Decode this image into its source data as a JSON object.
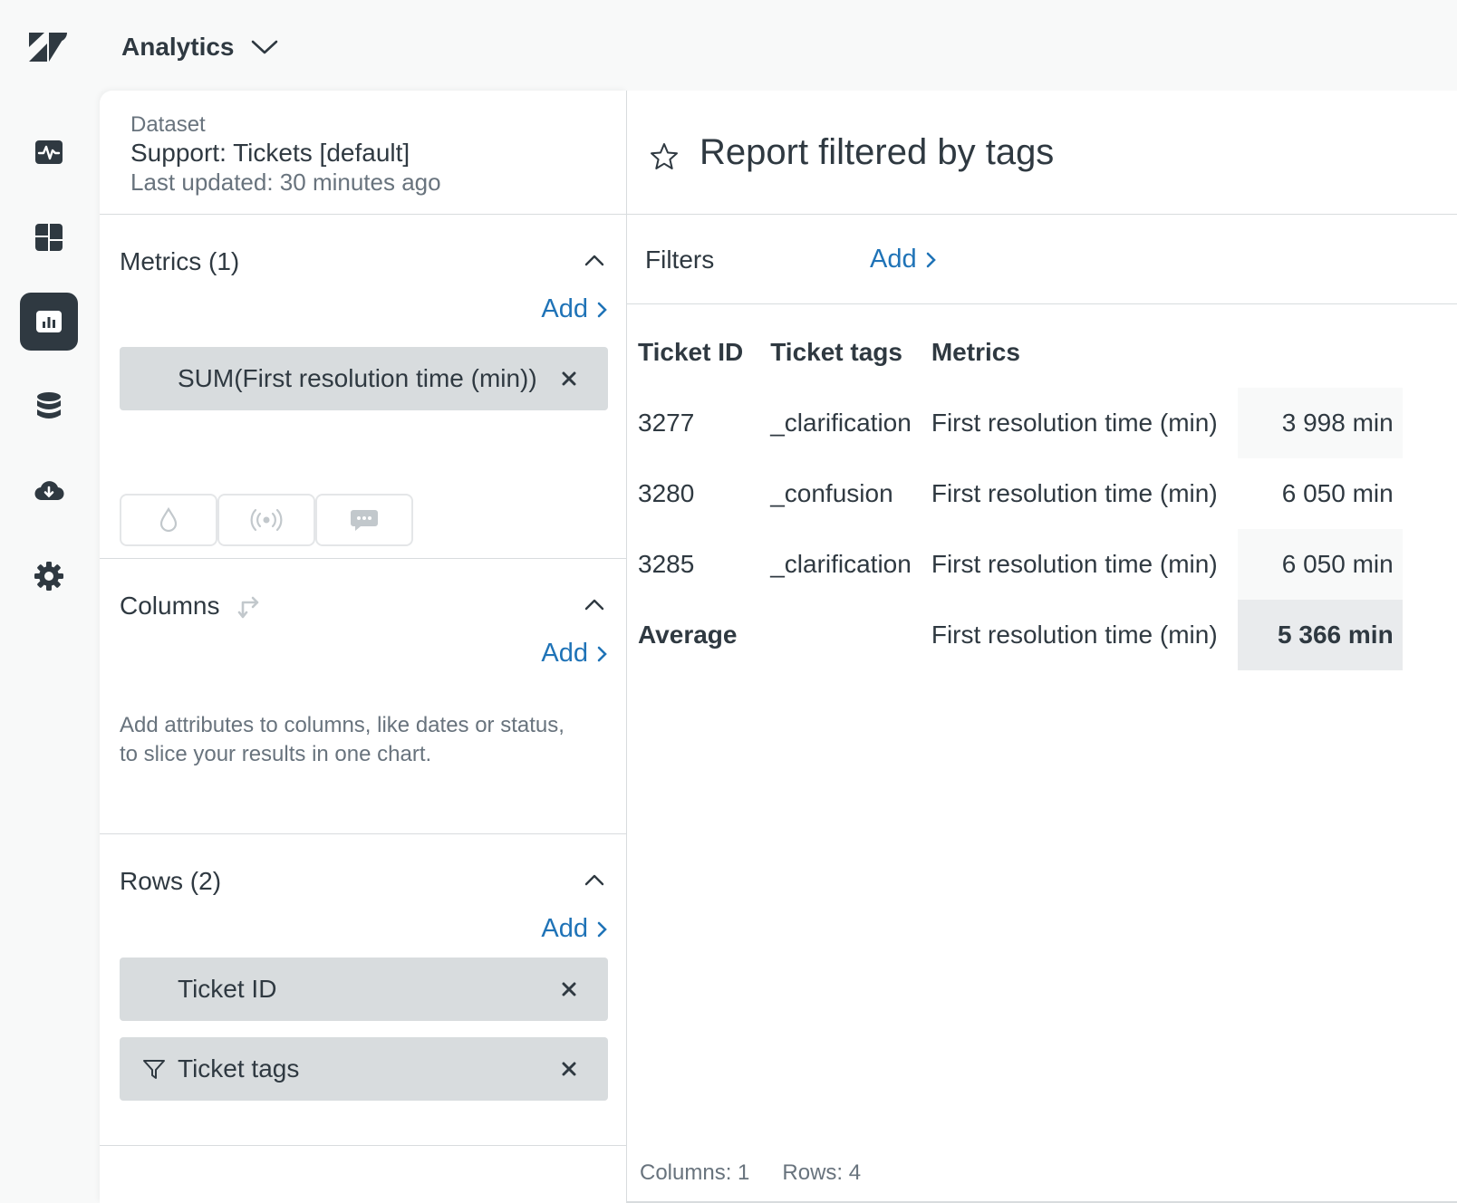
{
  "header": {
    "product": "Analytics"
  },
  "rail": {
    "items": [
      {
        "icon": "pulse-icon"
      },
      {
        "icon": "dashboard-icon"
      },
      {
        "icon": "reports-icon",
        "active": true
      },
      {
        "icon": "database-icon"
      },
      {
        "icon": "cloud-download-icon"
      },
      {
        "icon": "gear-icon"
      }
    ]
  },
  "dataset": {
    "label": "Dataset",
    "name": "Support: Tickets [default]",
    "updated": "Last updated: 30 minutes ago"
  },
  "metrics": {
    "title": "Metrics (1)",
    "add": "Add",
    "items": [
      "SUM(First resolution time (min))"
    ]
  },
  "columns": {
    "title": "Columns",
    "add": "Add",
    "hint": "Add attributes to columns, like dates or status, to slice your results in one chart."
  },
  "rows_section": {
    "title": "Rows (2)",
    "add": "Add",
    "items": [
      "Ticket ID",
      "Ticket tags"
    ]
  },
  "report": {
    "title": "Report filtered by tags",
    "filters_label": "Filters",
    "filters_add": "Add",
    "headers": [
      "Ticket ID",
      "Ticket tags",
      "Metrics"
    ],
    "rows": [
      {
        "id": "3277",
        "tag": "_clarification",
        "metric": "First resolution time (min)",
        "value": "3 998 min"
      },
      {
        "id": "3280",
        "tag": "_confusion",
        "metric": "First resolution time (min)",
        "value": "6 050 min"
      },
      {
        "id": "3285",
        "tag": "_clarification",
        "metric": "First resolution time (min)",
        "value": "6 050 min"
      }
    ],
    "average": {
      "label": "Average",
      "metric": "First resolution time (min)",
      "value": "5 366 min"
    },
    "footer": {
      "columns": "Columns: 1",
      "rows": "Rows: 4"
    }
  },
  "colors": {
    "accent": "#1f73b7",
    "text": "#2f3941",
    "muted": "#68737d",
    "pill": "#d8dcde"
  }
}
